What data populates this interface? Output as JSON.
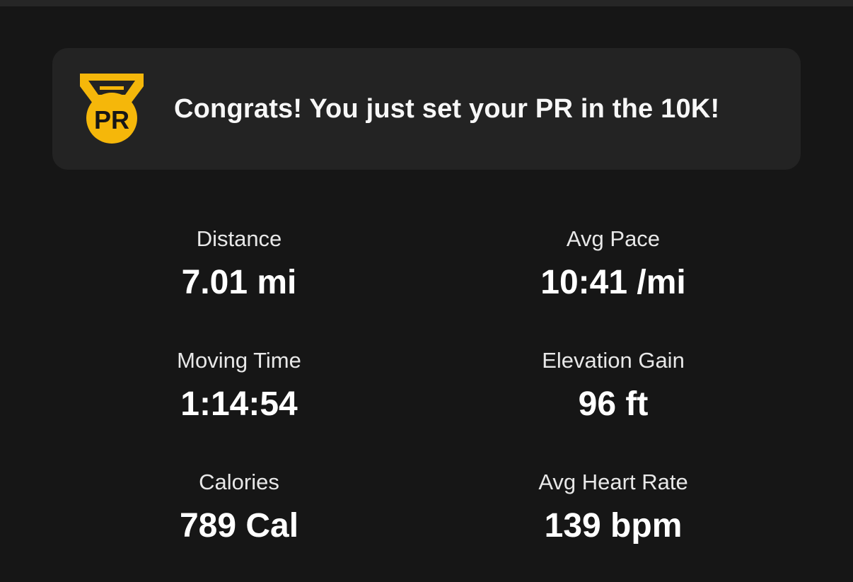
{
  "banner": {
    "icon": "pr-medal-icon",
    "medal_text": "PR",
    "message": "Congrats! You just set your PR in the 10K!",
    "accent_color": "#F5B70A"
  },
  "stats": [
    {
      "label": "Distance",
      "value": "7.01 mi"
    },
    {
      "label": "Avg Pace",
      "value": "10:41 /mi"
    },
    {
      "label": "Moving Time",
      "value": "1:14:54"
    },
    {
      "label": "Elevation Gain",
      "value": "96 ft"
    },
    {
      "label": "Calories",
      "value": "789 Cal"
    },
    {
      "label": "Avg Heart Rate",
      "value": "139 bpm"
    }
  ]
}
